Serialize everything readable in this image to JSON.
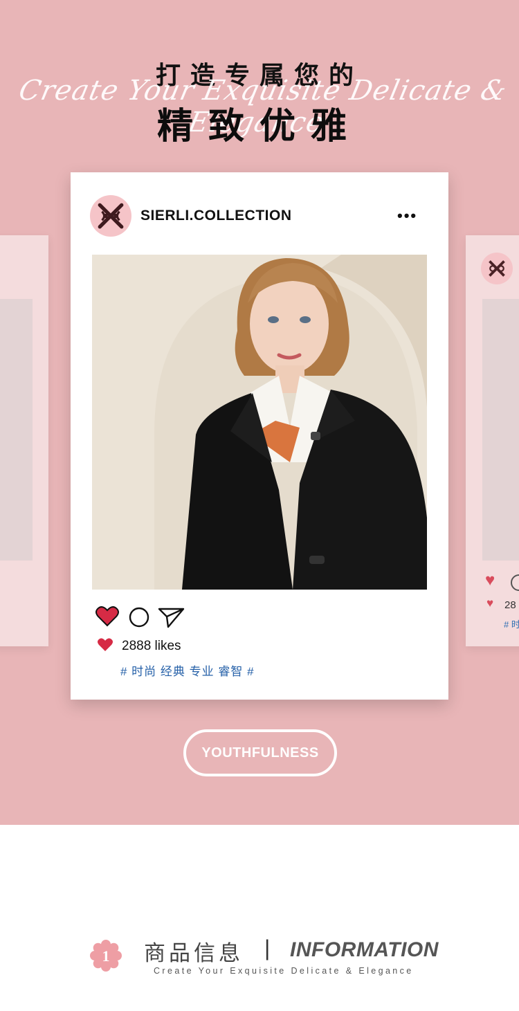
{
  "hero": {
    "title_top": "打造专属您的",
    "script_text": "Create Your Exquisite Delicate & Elegance",
    "title_main": "精致优雅"
  },
  "post": {
    "handle": "SIERLI.COLLECTION",
    "more_label": "•••",
    "likes_text": "2888 likes",
    "tags": "# 时尚 经典 专业 睿智 #"
  },
  "side_post": {
    "likes_text": "28",
    "tags": "# 时"
  },
  "cta": {
    "label": "YOUTHFULNESS"
  },
  "info": {
    "badge_number": "1",
    "title_zh": "商品信息",
    "separator": "|",
    "title_en": "INFORMATION",
    "subtitle": "Create Your Exquisite Delicate & Elegance"
  },
  "icons": [
    "logo-icon",
    "more-options-icon",
    "heart-icon",
    "comment-icon",
    "share-icon",
    "flower-badge-icon"
  ],
  "colors": {
    "hero_bg": "#e8b5b7",
    "card_bg": "#ffffff",
    "side_card_bg": "#f4dcdd",
    "heart": "#d62b45",
    "tag_blue": "#2560a8",
    "avatar_bg": "#f5c4c8",
    "badge": "#ee9ea4"
  }
}
